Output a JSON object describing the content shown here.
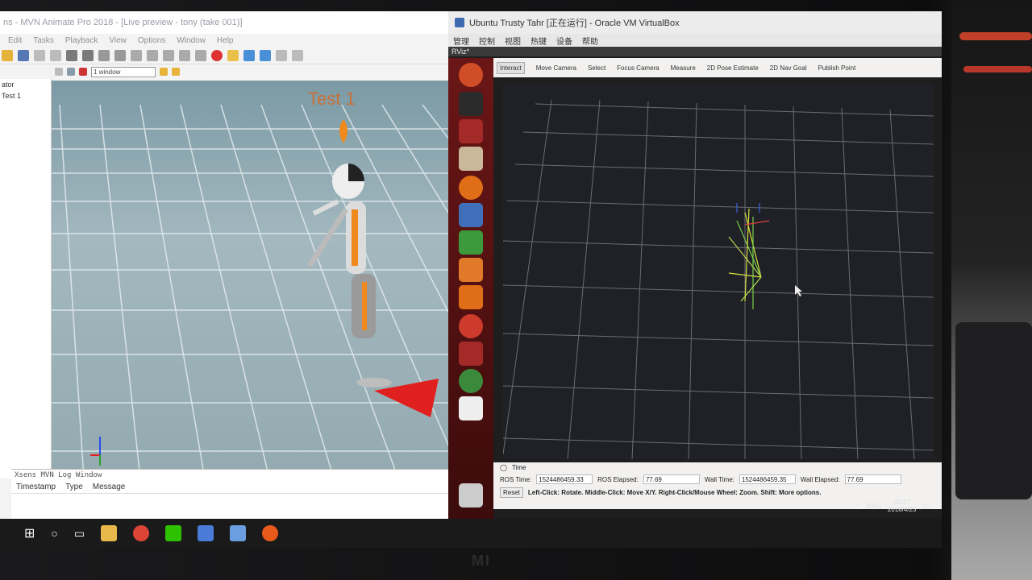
{
  "mvn": {
    "title": "ns - MVN Animate Pro 2018 - [Live preview - tony (take 001)]",
    "menu": [
      "Edit",
      "Tasks",
      "Playback",
      "View",
      "Options",
      "Window",
      "Help"
    ],
    "viewport_text": "Test 1",
    "window_select": "1 window",
    "side_header": "ator",
    "side_item": "Test 1",
    "log_title": "Xsens MVN Log Window",
    "log_columns": [
      "Timestamp",
      "Type",
      "Message"
    ]
  },
  "vbox": {
    "title": "Ubuntu Trusty Tahr [正在运行] - Oracle VM VirtualBox",
    "menu": [
      "管理",
      "控制",
      "视图",
      "热键",
      "设备",
      "帮助"
    ],
    "rviz_title": "RViz*",
    "tools": [
      "Interact",
      "Move Camera",
      "Select",
      "Focus Camera",
      "Measure",
      "2D Pose Estimate",
      "2D Nav Goal",
      "Publish Point"
    ],
    "time_panel_title": "Time",
    "ros_time_label": "ROS Time:",
    "ros_time": "1524486459.33",
    "ros_elapsed_label": "ROS Elapsed:",
    "ros_elapsed": "77.69",
    "wall_time_label": "Wall Time:",
    "wall_time": "1524486459.35",
    "wall_elapsed_label": "Wall Elapsed:",
    "wall_elapsed": "77.69",
    "reset": "Reset",
    "hint": "Left-Click: Rotate. Middle-Click: Move X/Y. Right-Click/Mouse Wheel: Zoom. Shift: More options."
  },
  "tray": {
    "lang": "ENG",
    "time": "20:27",
    "date": "2018/4/23"
  },
  "brand": "MI"
}
